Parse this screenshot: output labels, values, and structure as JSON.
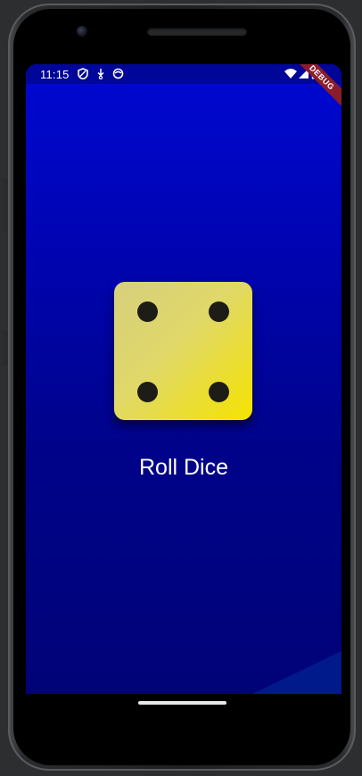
{
  "status_bar": {
    "time": "11:15",
    "left_icons": [
      "shield-icon",
      "download-icon",
      "sync-icon"
    ],
    "right_icons": [
      "wifi-icon",
      "signal-icon",
      "battery-icon"
    ]
  },
  "debug_banner": {
    "label": "DEBUG"
  },
  "dice": {
    "face_value": 4,
    "color_light": "#d6cf7e",
    "color_dark": "#f5e300",
    "pip_color": "#1d1c17"
  },
  "roll_button": {
    "label": "Roll Dice"
  },
  "colors": {
    "background_top": "#0008d2",
    "background_bottom": "#000377"
  }
}
